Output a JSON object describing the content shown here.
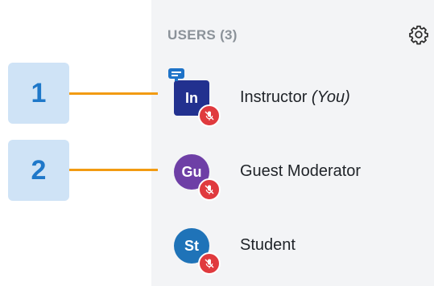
{
  "users_panel": {
    "header": "USERS (3)",
    "settings_icon": "gear-icon",
    "users": [
      {
        "initials": "In",
        "name": "Instructor",
        "suffix": "(You)",
        "avatar_color": "#22318f",
        "shape": "square",
        "is_presenter": true
      },
      {
        "initials": "Gu",
        "name": "Guest Moderator",
        "suffix": "",
        "avatar_color": "#6e3fa6",
        "shape": "round",
        "is_presenter": false
      },
      {
        "initials": "St",
        "name": "Student",
        "suffix": "",
        "avatar_color": "#1f73b8",
        "shape": "round",
        "is_presenter": false
      }
    ]
  },
  "callouts": [
    {
      "label": "1"
    },
    {
      "label": "2"
    }
  ],
  "colors": {
    "callout_bg": "#cfe3f6",
    "callout_text": "#1f78c9",
    "connector": "#f29b12",
    "muted_mic": "#e03a3e",
    "panel_bg": "#f3f4f6"
  }
}
